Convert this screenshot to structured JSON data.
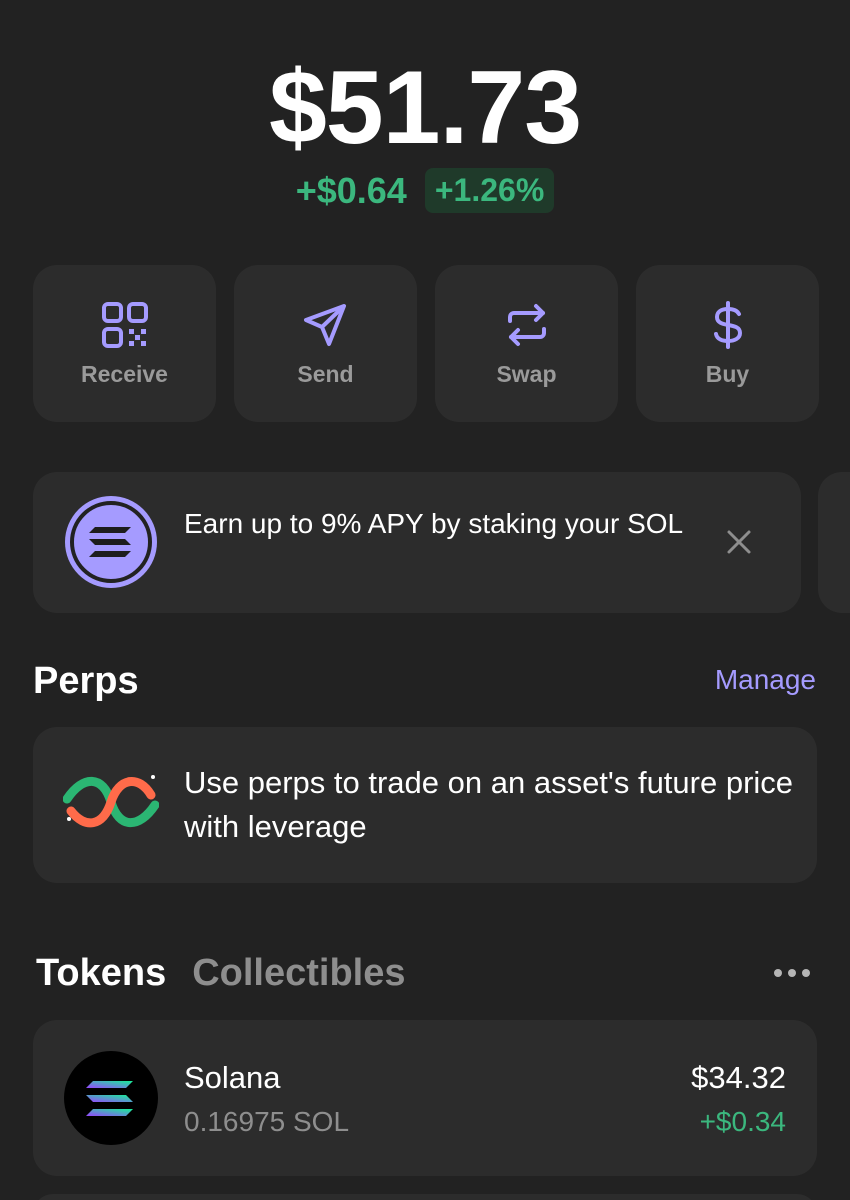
{
  "header": {
    "balance": "$51.73",
    "change_abs": "+$0.64",
    "change_pct": "+1.26%"
  },
  "actions": [
    {
      "label": "Receive",
      "icon": "qr-code-icon"
    },
    {
      "label": "Send",
      "icon": "send-arrow-icon"
    },
    {
      "label": "Swap",
      "icon": "swap-arrows-icon"
    },
    {
      "label": "Buy",
      "icon": "dollar-icon"
    }
  ],
  "promo": {
    "text": "Earn up to 9% APY by staking your SOL",
    "icon": "solana-icon"
  },
  "perps": {
    "title": "Perps",
    "manage_label": "Manage",
    "description": "Use perps to trade on an asset's future price with leverage",
    "icon": "perps-icon"
  },
  "tabs": {
    "tokens": "Tokens",
    "collectibles": "Collectibles"
  },
  "tokens": [
    {
      "name": "Solana",
      "amount": "0.16975 SOL",
      "value": "$34.32",
      "change": "+$0.34",
      "icon": "solana-logo-icon"
    }
  ],
  "colors": {
    "background": "#222222",
    "card": "#2c2c2c",
    "positive": "#3bb77e",
    "accent": "#a59bff"
  }
}
